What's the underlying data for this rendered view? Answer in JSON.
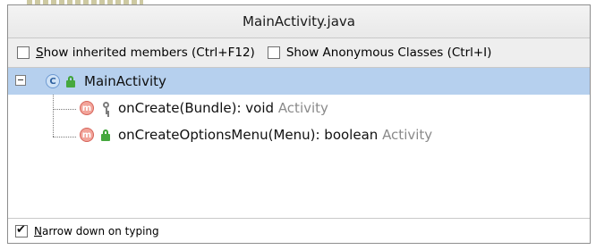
{
  "popup": {
    "title": "MainActivity.java"
  },
  "options": {
    "inherited": {
      "prefix": "",
      "mnemonic": "S",
      "rest": "how inherited members (Ctrl+F12)",
      "checked": false
    },
    "anonymous": {
      "label": "Show Anonymous Classes (Ctrl+I)",
      "checked": false
    }
  },
  "tree": {
    "root": {
      "label": "MainActivity",
      "icon": "class-icon",
      "access": "public-lock-icon",
      "expanded": true
    },
    "children": [
      {
        "label": "onCreate(Bundle): void",
        "origin": "Activity",
        "icon": "method-icon",
        "access": "protected-key-icon"
      },
      {
        "label": "onCreateOptionsMenu(Menu): boolean",
        "origin": "Activity",
        "icon": "method-icon",
        "access": "public-lock-icon"
      }
    ]
  },
  "footer": {
    "narrow": {
      "mnemonic": "N",
      "rest": "arrow down on typing",
      "checked": true
    }
  },
  "colors": {
    "selection": "#b6d0ee",
    "method_icon": "#f2a49a",
    "class_icon": "#cfe2f6",
    "public_access": "#46a83e"
  }
}
